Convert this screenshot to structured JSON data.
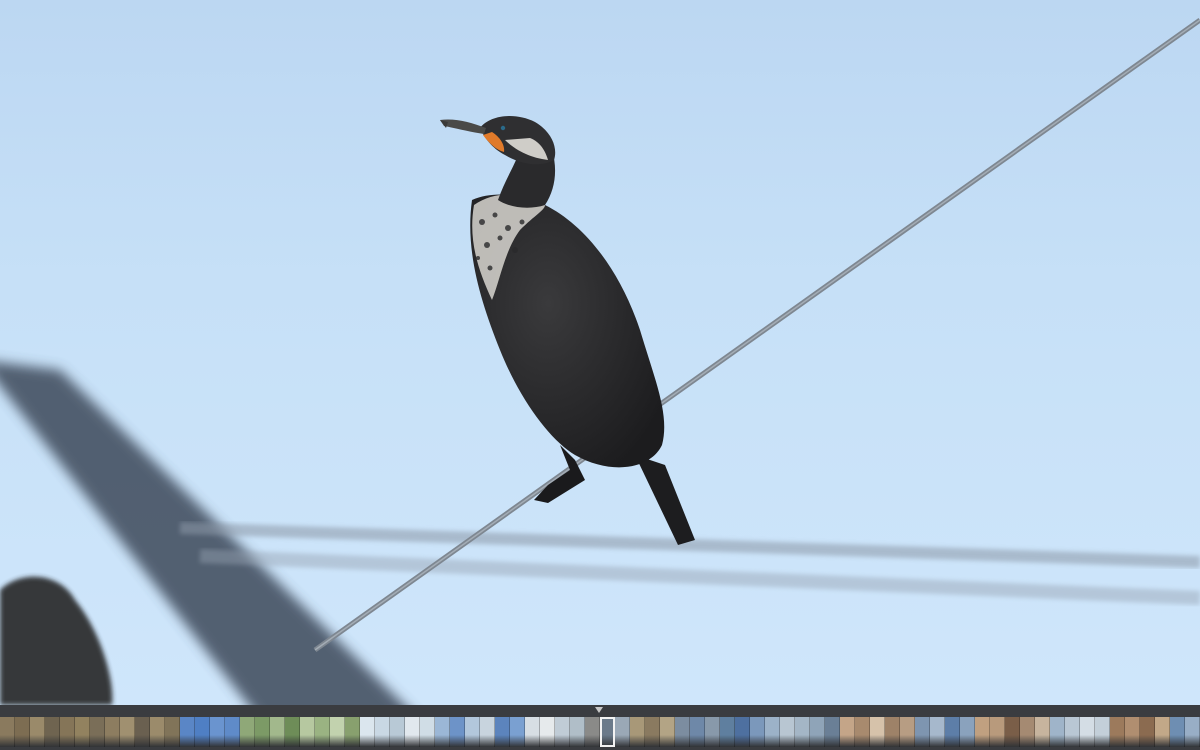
{
  "viewer": {
    "photo_subject": "cormorant-on-wire"
  },
  "colors": {
    "sky": "#c6e0f7",
    "filmstrip_bg": "#3a3c40",
    "marker": "#c8c8c8"
  },
  "filmstrip": {
    "current_index": 40,
    "thumbnails": [
      "#8a7a5e",
      "#7d6d52",
      "#9a8a6a",
      "#6f6450",
      "#857558",
      "#92825f",
      "#7a6e58",
      "#8d7d60",
      "#a09070",
      "#6a6050",
      "#9b8b6b",
      "#817459",
      "#5a86c6",
      "#4f7fc4",
      "#6a94cf",
      "#5f8bc9",
      "#8fa878",
      "#7c9a66",
      "#a2b88c",
      "#6e8d58",
      "#b6c8a0",
      "#9ab382",
      "#c2d2ae",
      "#88a06e",
      "#dbe6ee",
      "#c9d8e4",
      "#b8c9d6",
      "#e1e8ee",
      "#d0dde6",
      "#9bb7d6",
      "#6d93c8",
      "#b2c7dc",
      "#c8d4de",
      "#5c84bd",
      "#7aa0d1",
      "#d7dee4",
      "#e6eaec",
      "#c0ccd6",
      "#b0bec8",
      "#8a8a88",
      "#6b7a8a",
      "#9aa8b6",
      "#a89878",
      "#8a7a60",
      "#b3a485",
      "#7c8da0",
      "#6e88a8",
      "#8899aa",
      "#5f7f9f",
      "#4e70a0",
      "#7b98bb",
      "#9cb2c8",
      "#b8c6d2",
      "#a4b6c6",
      "#8fa4b8",
      "#6a7f96",
      "#c4a588",
      "#a88a6e",
      "#d6c2aa",
      "#9e8268",
      "#b79d83",
      "#7e95b0",
      "#a6b8cc",
      "#5d7ea8",
      "#8aa2bd",
      "#c0a080",
      "#b89a7c",
      "#7a5e48",
      "#a58a72",
      "#c7b49e",
      "#9fb4c9",
      "#b9c7d4",
      "#d4dde5",
      "#c3cfd9",
      "#9c7a5c",
      "#b08e70",
      "#8b6b50",
      "#c2a888",
      "#6e8eb2",
      "#98aec6"
    ]
  }
}
